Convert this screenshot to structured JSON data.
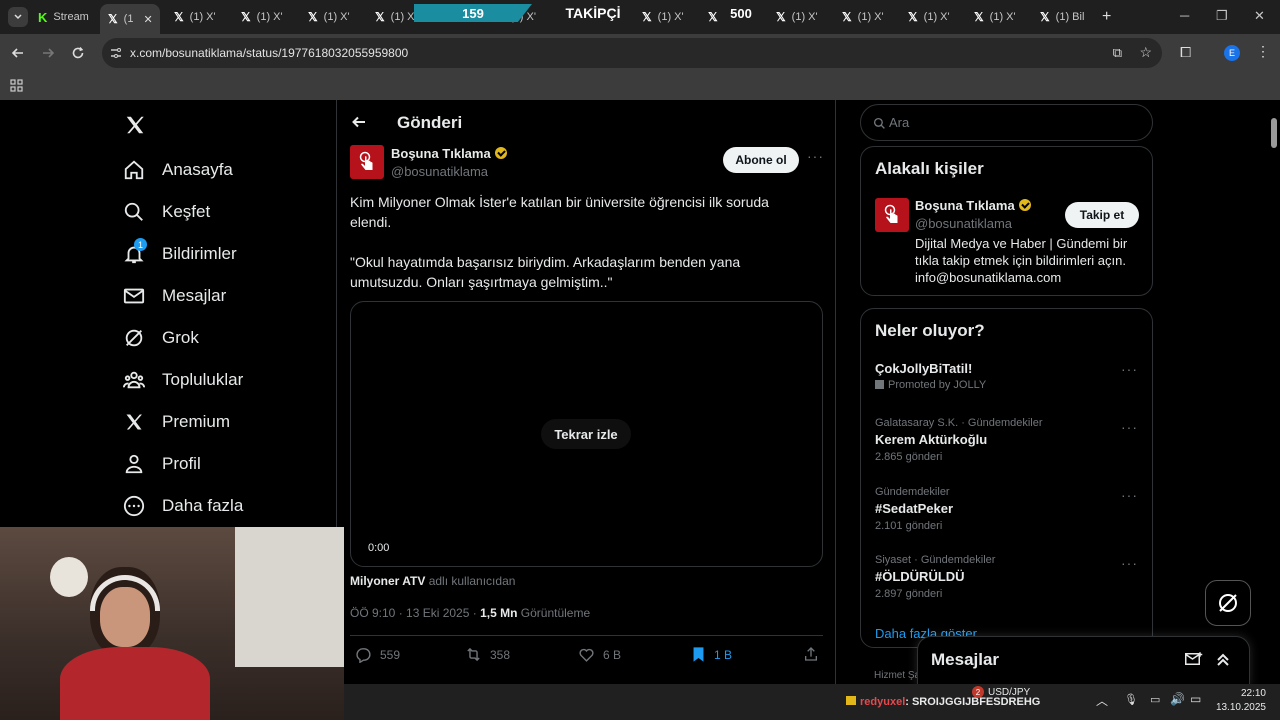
{
  "browser": {
    "tabs": [
      {
        "label": "Stream"
      },
      {
        "label": "(1"
      },
      {
        "label": "(1) X'"
      },
      {
        "label": "(1) X'"
      },
      {
        "label": "(1) X'"
      },
      {
        "label": "(1) X"
      },
      {
        "label": "(1) X'"
      },
      {
        "label": "(1) X'"
      },
      {
        "label": "(1) X'"
      },
      {
        "label": "(1) X'"
      },
      {
        "label": "(1) X'"
      },
      {
        "label": "(1) X'"
      },
      {
        "label": "(1) Bil"
      }
    ],
    "url": "x.com/bosunatiklama/status/1977618032055959800",
    "profile_initial": "E"
  },
  "overlay": {
    "count_left": "159",
    "label": "TAKİPÇİ",
    "count_right": "500"
  },
  "nav": {
    "items": [
      {
        "label": "Anasayfa",
        "icon": "home-icon"
      },
      {
        "label": "Keşfet",
        "icon": "search-icon"
      },
      {
        "label": "Bildirimler",
        "icon": "bell-icon",
        "badge": "1"
      },
      {
        "label": "Mesajlar",
        "icon": "mail-icon"
      },
      {
        "label": "Grok",
        "icon": "grok-icon"
      },
      {
        "label": "Topluluklar",
        "icon": "communities-icon"
      },
      {
        "label": "Premium",
        "icon": "x-logo-icon"
      },
      {
        "label": "Profil",
        "icon": "person-icon"
      },
      {
        "label": "Daha fazla",
        "icon": "more-circle-icon"
      }
    ]
  },
  "post": {
    "header_title": "Gönderi",
    "author_name": "Boşuna Tıklama",
    "author_handle": "@bosunatiklama",
    "subscribe_label": "Abone ol",
    "text_1a": "Kim Milyoner Olmak İster'e katılan bir üniversite öğrencisi ilk soruda",
    "text_1b": "elendi.",
    "text_2a": "\"Okul hayatımda başarısız biriydim. Arkadaşlarım benden yana",
    "text_2b": "umutsuzdu. Onları şaşırtmaya gelmiştim..\"",
    "video_replay": "Tekrar izle",
    "video_time": "0:00",
    "source_name": "Milyoner ATV",
    "source_suffix": "adlı kullanıcıdan",
    "meta_time": "ÖÖ 9:10 · 13 Eki 2025 ·",
    "views": "1,5 Mn",
    "views_label": "Görüntüleme",
    "replies": "559",
    "reposts": "358",
    "likes": "6 B",
    "bookmarks": "1 B"
  },
  "sidebar": {
    "search_placeholder": "Ara",
    "related_title": "Alakalı kişiler",
    "related_name": "Boşuna Tıklama",
    "related_handle": "@bosunatiklama",
    "follow_label": "Takip et",
    "bio_1": "Dijital Medya ve Haber | Gündemi bir",
    "bio_2": "tıkla takip etmek için bildirimleri açın.",
    "bio_3": "info@bosunatiklama.com",
    "whats_title": "Neler oluyor?",
    "trends": [
      {
        "context": "",
        "title": "ÇokJollyBiTatil!",
        "meta": "Promoted by JOLLY"
      },
      {
        "context": "Galatasaray S.K. · Gündemdekiler",
        "title": "Kerem Aktürkoğlu",
        "meta": "2.865 gönderi"
      },
      {
        "context": "Gündemdekiler",
        "title": "#SedatPeker",
        "meta": "2.101 gönderi"
      },
      {
        "context": "Siyaset · Gündemdekiler",
        "title": "#ÖLDÜRÜLDÜ",
        "meta": "2.897 gönderi"
      }
    ],
    "show_more": "Daha fazla göster",
    "footer_peek": "Hizmet Şa"
  },
  "messages_drawer": {
    "title": "Mesajlar"
  },
  "taskbar": {
    "chat_user": "redyuxel",
    "chat_message": ": SROIJGGIJBFESDREHG",
    "ticker_badge": "2",
    "ticker": "USD/JPY",
    "time": "22:10",
    "date": "13.10.2025"
  },
  "colors": {
    "accent": "#1d9bf0",
    "brand_red": "#b5121b",
    "verified_gold": "#e2b719",
    "overlay_teal": "#1a8ea0"
  }
}
